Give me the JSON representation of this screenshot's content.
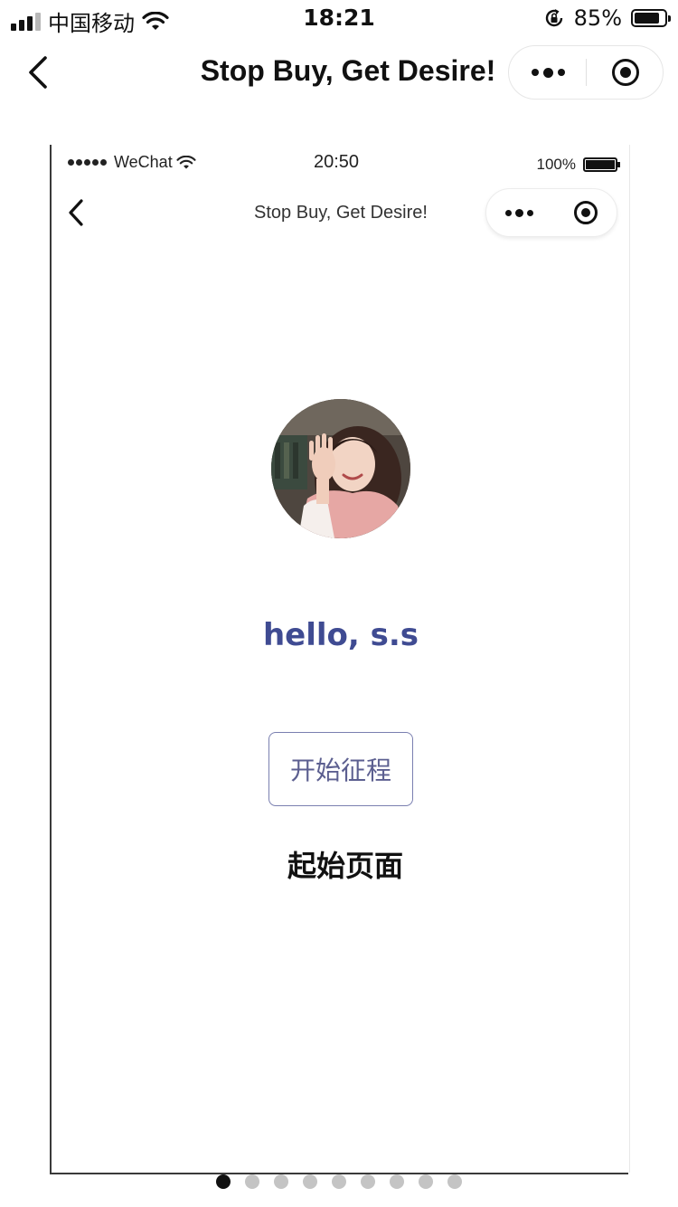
{
  "status_bar": {
    "carrier": "中国移动",
    "time": "18:21",
    "battery_percent": "85%",
    "battery_level": 0.85,
    "icons": [
      "signal-icon",
      "wifi-icon",
      "rotation-lock-icon",
      "battery-icon"
    ]
  },
  "nav_bar": {
    "title": "Stop Buy, Get Desire!",
    "back_icon": "chevron-left-icon",
    "more_icon": "more-dots-icon",
    "close_icon": "target-close-icon"
  },
  "preview": {
    "status_bar": {
      "carrier": "WeChat",
      "time": "20:50",
      "battery_percent": "100%",
      "battery_level": 1.0
    },
    "nav_bar": {
      "title": "Stop Buy, Get Desire!"
    },
    "greeting": "hello, s.s",
    "start_button_label": "开始征程",
    "page_label": "起始页面",
    "colors": {
      "greeting": "#3f4b92",
      "button_border": "#7a7fb0",
      "button_text": "#5c5f90"
    }
  },
  "pager": {
    "total": 9,
    "active_index": 0
  }
}
